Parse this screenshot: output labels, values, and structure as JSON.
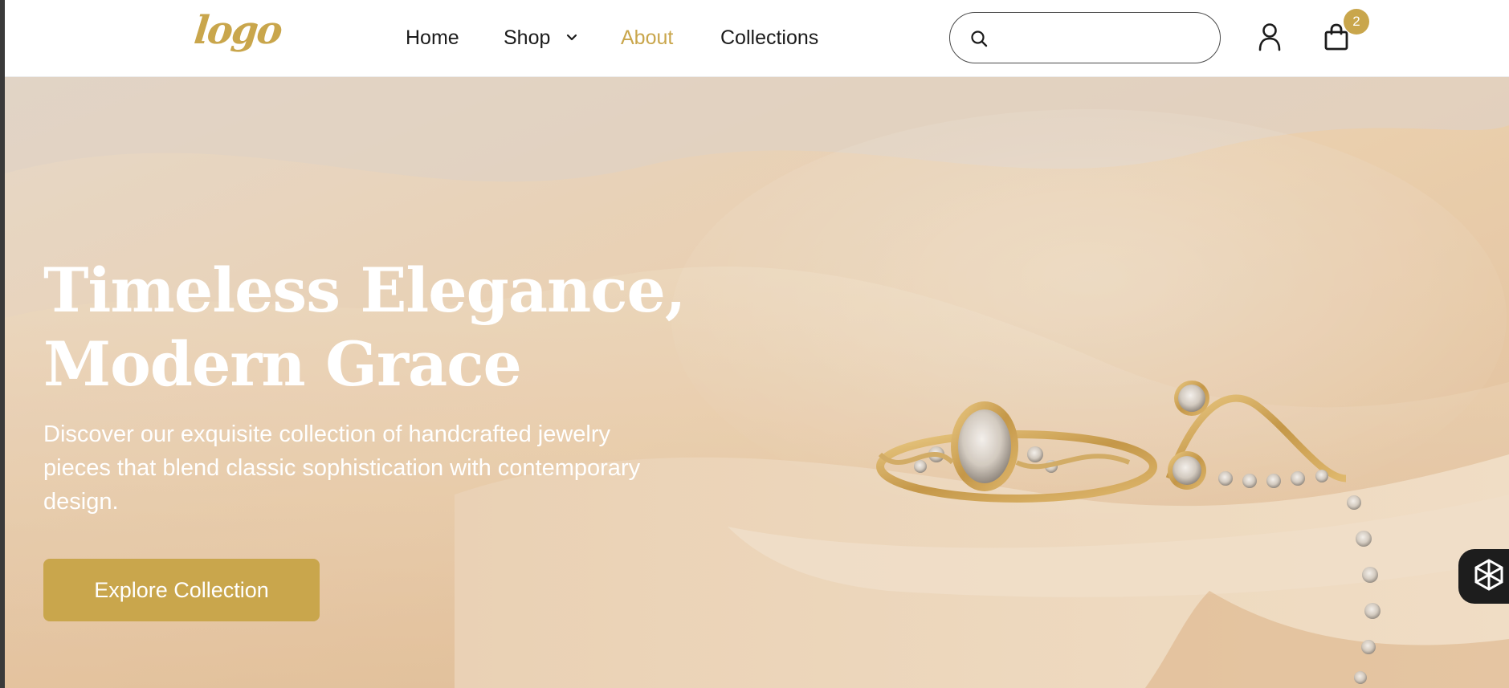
{
  "header": {
    "logo_text": "logo",
    "nav": [
      {
        "label": "Home",
        "active": false
      },
      {
        "label": "Shop",
        "active": false,
        "has_dropdown": true
      },
      {
        "label": "About",
        "active": true
      },
      {
        "label": "Collections",
        "active": false
      }
    ],
    "search": {
      "placeholder": "",
      "value": ""
    },
    "account_icon": "user-icon",
    "cart": {
      "icon": "shopping-bag-icon",
      "count": "2"
    }
  },
  "hero": {
    "title_line1": "Timeless Elegance,",
    "title_line2": "Modern Grace",
    "description": "Discover our exquisite collection of handcrafted jewelry pieces that blend classic sophistication with contemporary design.",
    "cta_label": "Explore Collection",
    "image_alt": "gold-diamond-rings-on-silk"
  },
  "chat_widget": {
    "icon": "chat-assistant-icon"
  },
  "colors": {
    "accent": "#c9a64c",
    "text_dark": "#1b1b1b",
    "header_bg": "#ffffff",
    "hero_text": "#ffffff",
    "chat_widget_bg": "#1d1d1d"
  }
}
